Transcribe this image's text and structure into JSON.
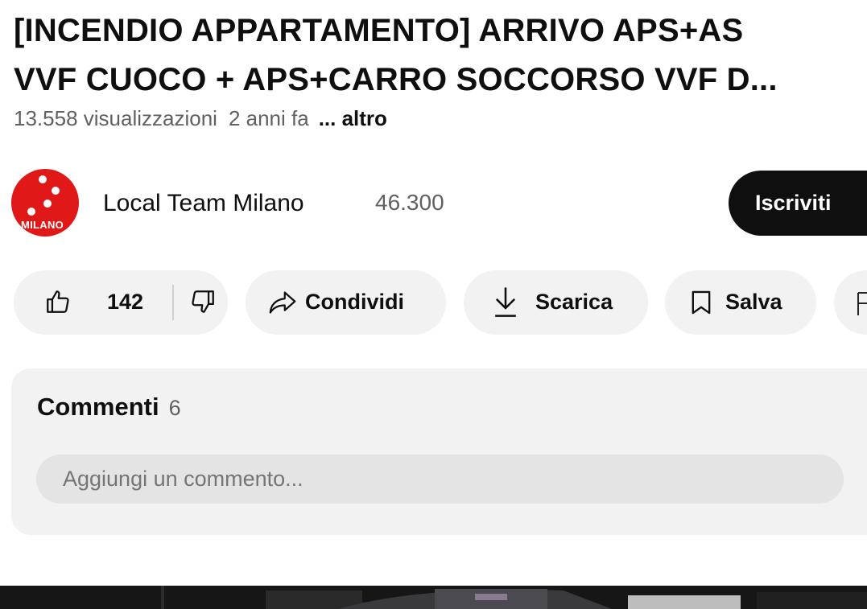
{
  "video": {
    "title_line1": "[INCENDIO APPARTAMENTO] ARRIVO APS+AS",
    "title_line2": "VVF CUOCO + APS+CARRO SOCCORSO VVF D...",
    "views": "13.558 visualizzazioni",
    "age": "2 anni fa",
    "more_label": "... altro"
  },
  "channel": {
    "name": "Local Team Milano",
    "subscribers": "46.300",
    "avatar_text": "MILANO",
    "subscribe_label": "Iscriviti",
    "avatar_color": "#e01818"
  },
  "actions": {
    "like_count": "142",
    "share_label": "Condividi",
    "download_label": "Scarica",
    "save_label": "Salva"
  },
  "comments": {
    "heading": "Commenti",
    "count": "6",
    "placeholder": "Aggiungi un commento..."
  },
  "icons": {
    "like": "thumbs-up-icon",
    "dislike": "thumbs-down-icon",
    "share": "share-arrow-icon",
    "download": "download-icon",
    "save": "bookmark-icon",
    "clip": "clip-icon"
  }
}
